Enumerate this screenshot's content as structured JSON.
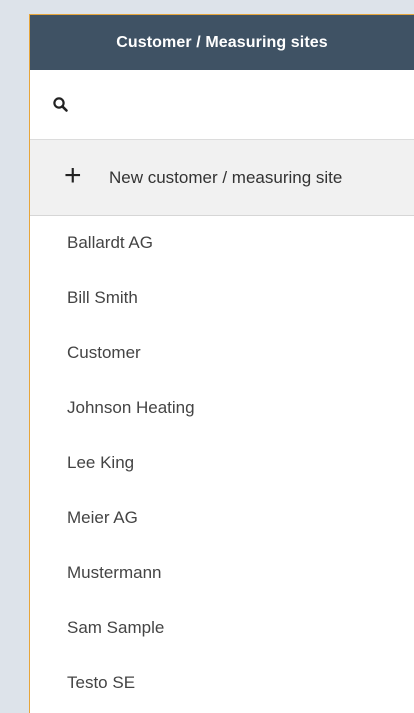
{
  "header": {
    "title": "Customer / Measuring sites"
  },
  "search": {
    "icon": "search-icon",
    "value": ""
  },
  "new_entry": {
    "icon": "plus-icon",
    "label": "New customer / measuring site"
  },
  "customers": [
    "Ballardt AG",
    "Bill Smith",
    "Customer",
    "Johnson Heating",
    "Lee King",
    "Meier AG",
    "Mustermann",
    "Sam Sample",
    "Testo SE"
  ],
  "colors": {
    "header_bg": "#3f5264",
    "header_text": "#ffffff",
    "accent_border": "#e6a53b",
    "new_row_bg": "#f1f1f1",
    "page_bg": "#dde3ea"
  }
}
